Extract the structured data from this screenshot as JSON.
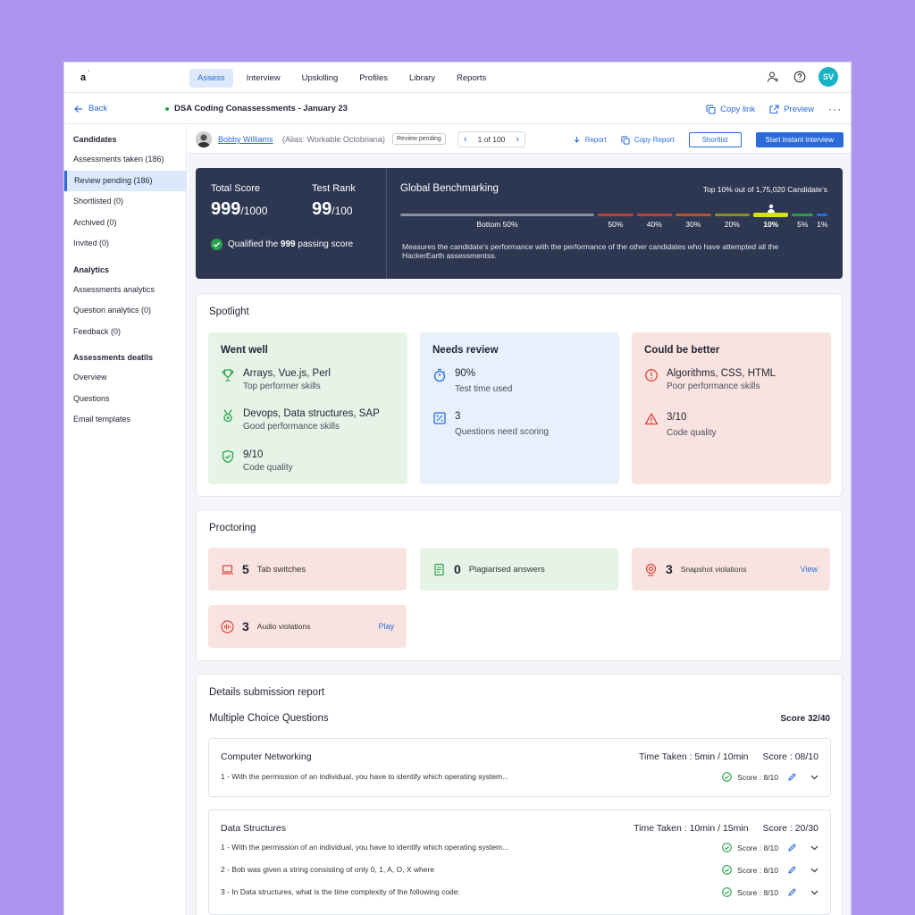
{
  "app": {
    "logo_text": "a",
    "logo_mark": "`"
  },
  "nav": {
    "tabs": [
      "Assess",
      "Interview",
      "Upskilling",
      "Profiles",
      "Library",
      "Reports"
    ],
    "active_tab": "Assess",
    "avatar_initials": "SV"
  },
  "subheader": {
    "back_label": "Back",
    "test_title": "DSA Coding Conassessments - January 23",
    "copy_link": "Copy link",
    "preview": "Preview",
    "more": "···"
  },
  "sidebar": {
    "sections": [
      {
        "heading": "Candidates",
        "items": [
          "Assessments taken (186)",
          "Review pending (186)",
          "Shortlisted (0)",
          "Archived (0)",
          "Invited (0)"
        ]
      },
      {
        "heading": "Analytics",
        "items": [
          "Assessments analytics",
          "Question analytics (0)",
          "Feedback (0)"
        ]
      },
      {
        "heading": "Assessments deatils",
        "items": [
          "Overview",
          "Questions",
          "Email templates"
        ]
      }
    ],
    "active_item": "Review pending (186)"
  },
  "candidate": {
    "name": "Bobby Williams",
    "alias": "(Alias: Workable Octobriana)",
    "status_badge": "Review pending",
    "pager": "1 of 100",
    "report": "Report",
    "copy_report": "Copy Report",
    "shortlist": "Shortlist",
    "start_interview": "Start instant interview"
  },
  "scores": {
    "total_label": "Total Score",
    "total_value": "999",
    "total_max": "/1000",
    "rank_label": "Test Rank",
    "rank_value": "99",
    "rank_max": "/100",
    "qualified_prefix": "Qualified the ",
    "qualified_value": "999",
    "qualified_suffix": " passing score"
  },
  "benchmark": {
    "title": "Global Benchmarking",
    "top_text": "Top 10% out of 1,75,020 Candidate’s",
    "description": "Measures the candidate's performance with the performance of the other candidates who have attempted all the HackerEarth assessmentss.",
    "segments": [
      {
        "label": "Bottom 50%",
        "color": "#8a90a3",
        "weight": 11
      },
      {
        "label": "50%",
        "color": "#b8443f",
        "weight": 2
      },
      {
        "label": "40%",
        "color": "#b8443f",
        "weight": 2
      },
      {
        "label": "30%",
        "color": "#b3572b",
        "weight": 2
      },
      {
        "label": "20%",
        "color": "#8f8c25",
        "weight": 2
      },
      {
        "label": "10%",
        "color": "#d6e01e",
        "weight": 2,
        "highlight": true
      },
      {
        "label": "5%",
        "color": "#2e9a4b",
        "weight": 1.2
      },
      {
        "label": "1%",
        "color": "#2b6ad8",
        "weight": 0.6
      }
    ]
  },
  "spotlight": {
    "title": "Spotlight",
    "went_well": {
      "title": "Went well",
      "items": [
        {
          "icon": "trophy-icon",
          "main": "Arrays, Vue.js, Perl",
          "sub": "Top performer skills"
        },
        {
          "icon": "medal-icon",
          "main": "Devops, Data structures, SAP",
          "sub": "Good performance skills"
        },
        {
          "icon": "shield-check-icon",
          "main": "9/10",
          "sub": "Code quality"
        }
      ]
    },
    "needs_review": {
      "title": "Needs review",
      "items": [
        {
          "icon": "timer-icon",
          "main": "90%",
          "sub": "Test time used"
        },
        {
          "icon": "scoring-icon",
          "main": "3",
          "sub": "Questions need scoring"
        }
      ]
    },
    "could_be_better": {
      "title": "Could be better",
      "items": [
        {
          "icon": "alert-circle-icon",
          "main": "Algorithms, CSS, HTML",
          "sub": "Poor performance skills"
        },
        {
          "icon": "warning-icon",
          "main": "3/10",
          "sub": "Code quality"
        }
      ]
    }
  },
  "proctoring": {
    "title": "Proctoring",
    "items": [
      {
        "count": "5",
        "label": "Tab switches",
        "link": ""
      },
      {
        "count": "0",
        "label": "Plagiarised answers",
        "link": ""
      },
      {
        "count": "3",
        "label": "Snapshot violations",
        "link": "View"
      },
      {
        "count": "3",
        "label": "Audio violations",
        "link": "Play"
      }
    ]
  },
  "details": {
    "title": "Details submission report",
    "section_title": "Multiple Choice Questions",
    "section_score": "Score 32/40",
    "groups": [
      {
        "name": "Computer Networking",
        "time": "Time Taken : 5min / 10min",
        "score": "Score : 08/10",
        "questions": [
          {
            "text": "1 - With the permission of an individual, you have to identify which operating system...",
            "score": "Score : 8/10"
          }
        ]
      },
      {
        "name": "Data Structures",
        "time": "Time Taken : 10min / 15min",
        "score": "Score : 20/30",
        "questions": [
          {
            "text": "1 - With the permission of an individual, you have to identify which operating system...",
            "score": "Score : 8/10"
          },
          {
            "text": "2 - Bob was given a string consisting of only 0, 1, A, O, X where",
            "score": "Score : 8/10"
          },
          {
            "text": "3 - In Data structures, what is the time complexity of the following code:",
            "score": "Score : 8/10"
          }
        ]
      }
    ]
  }
}
